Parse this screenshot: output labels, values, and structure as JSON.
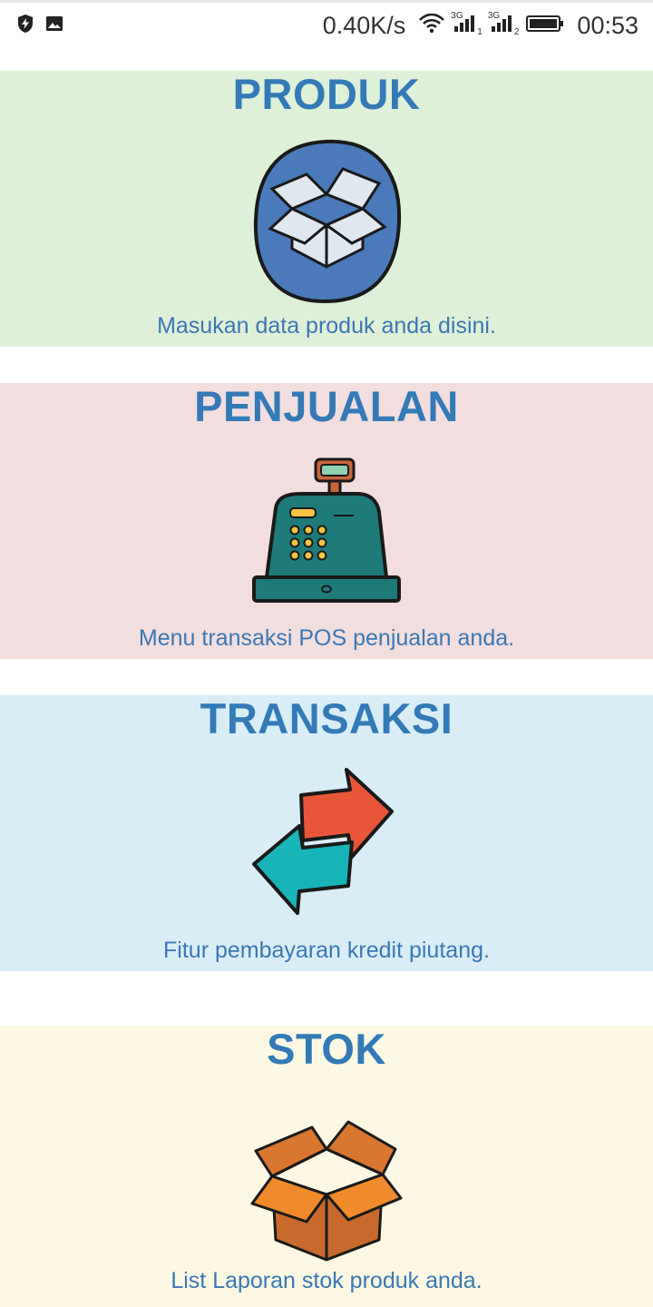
{
  "status_bar": {
    "network_speed": "0.40K/s",
    "sim1_type": "3G",
    "sim1_index": "1",
    "sim2_type": "3G",
    "sim2_index": "2",
    "time": "00:53",
    "icons": [
      "shield-bolt-icon",
      "image-icon",
      "wifi-icon",
      "signal-icon",
      "signal-icon",
      "battery-icon"
    ]
  },
  "menu": [
    {
      "title": "PRODUK",
      "description": "Masukan data produk anda disini.",
      "icon": "open-box-icon",
      "bg": "#dff0d8"
    },
    {
      "title": "PENJUALAN",
      "description": "Menu transaksi POS penjualan anda.",
      "icon": "cash-register-icon",
      "bg": "#f2dede"
    },
    {
      "title": "TRANSAKSI",
      "description": "Fitur pembayaran kredit piutang.",
      "icon": "exchange-arrows-icon",
      "bg": "#d9edf7"
    },
    {
      "title": "STOK",
      "description": "List Laporan stok produk anda.",
      "icon": "cardboard-box-icon",
      "bg": "#fcf8e3"
    }
  ],
  "colors": {
    "title": "#337ab7",
    "text": "#3a78b5"
  }
}
